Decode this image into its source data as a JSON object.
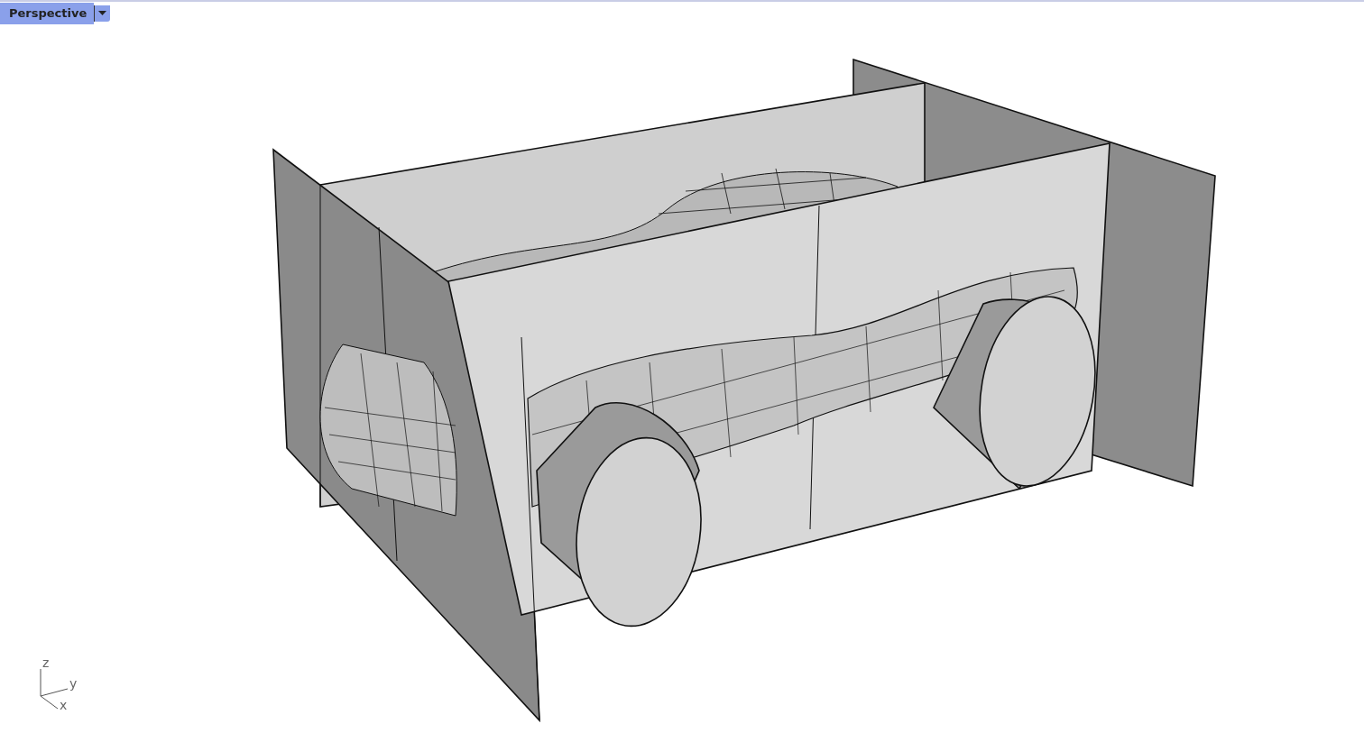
{
  "viewport": {
    "title": "Perspective",
    "axes": {
      "z": "z",
      "y": "y",
      "x": "x"
    }
  }
}
